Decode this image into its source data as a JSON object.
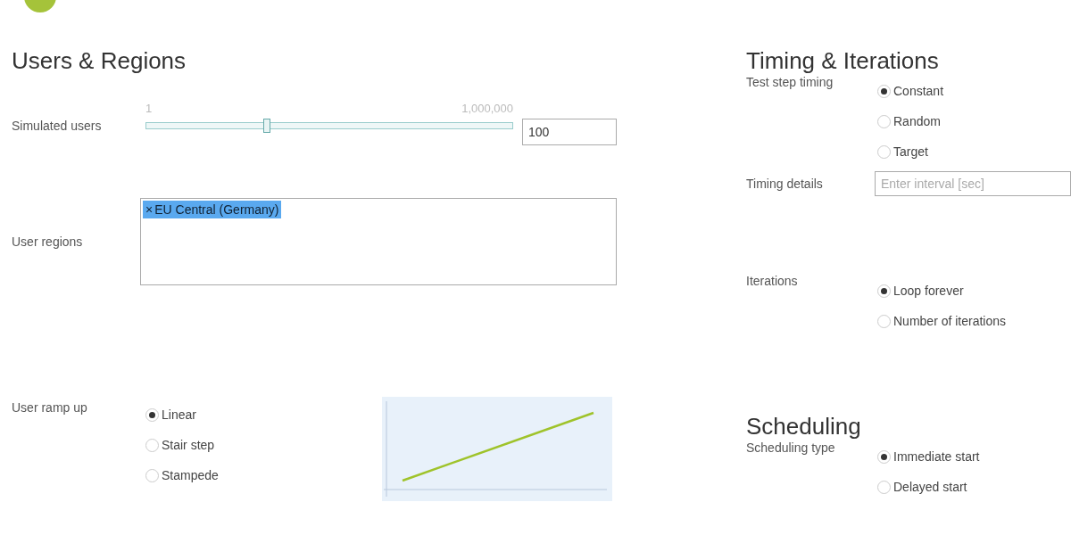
{
  "users_regions": {
    "title": "Users & Regions",
    "simulated_users": {
      "label": "Simulated users",
      "min_label": "1",
      "max_label": "1,000,000",
      "level": 0.33,
      "value": "100"
    },
    "user_regions": {
      "label": "User regions",
      "tags": [
        {
          "remove": "×",
          "label": "EU Central (Germany)"
        }
      ]
    },
    "user_ramp_up": {
      "label": "User ramp up",
      "options": [
        {
          "label": "Linear",
          "selected": true
        },
        {
          "label": "Stair step",
          "selected": false
        },
        {
          "label": "Stampede",
          "selected": false
        }
      ]
    }
  },
  "timing_iterations": {
    "title": "Timing & Iterations",
    "test_step_timing": {
      "label": "Test step timing",
      "options": [
        {
          "label": "Constant",
          "selected": true
        },
        {
          "label": "Random",
          "selected": false
        },
        {
          "label": "Target",
          "selected": false
        }
      ]
    },
    "timing_details": {
      "label": "Timing details",
      "placeholder": "Enter interval [sec]"
    },
    "iterations": {
      "label": "Iterations",
      "options": [
        {
          "label": "Loop forever",
          "selected": true
        },
        {
          "label": "Number of iterations",
          "selected": false
        }
      ]
    }
  },
  "scheduling": {
    "title": "Scheduling",
    "scheduling_type": {
      "label": "Scheduling type",
      "options": [
        {
          "label": "Immediate start",
          "selected": true
        },
        {
          "label": "Delayed start",
          "selected": false
        }
      ]
    }
  }
}
